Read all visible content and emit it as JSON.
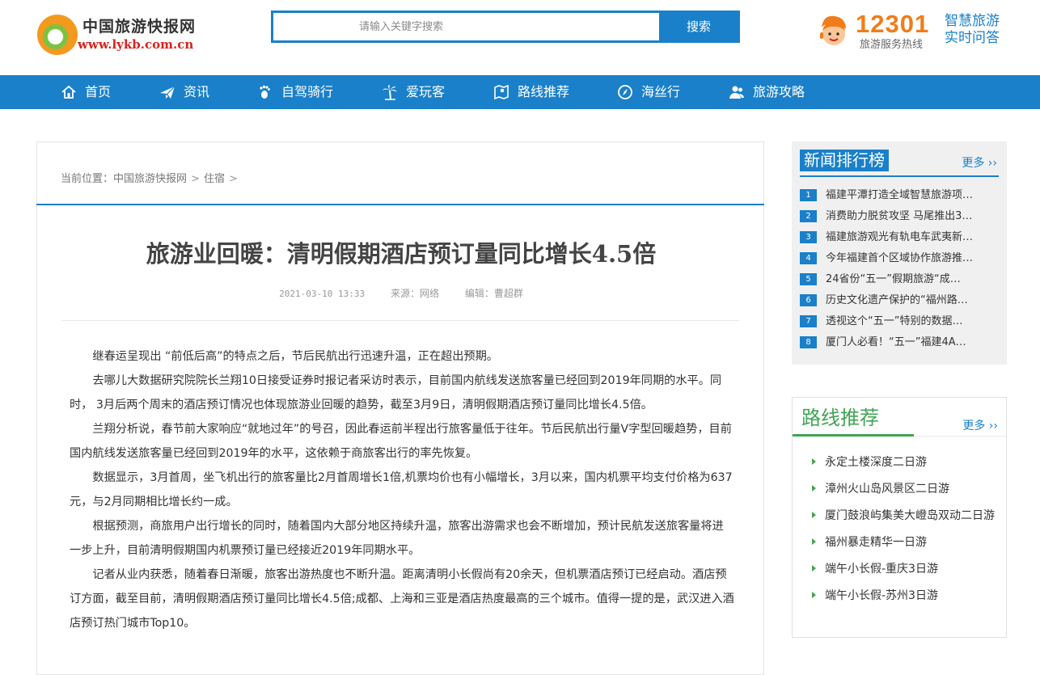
{
  "site": {
    "logo_cn": "中国旅游快报网",
    "logo_url": "www.lykb.com.cn"
  },
  "search": {
    "placeholder": "请输入关键字搜索",
    "button": "搜索"
  },
  "hotline": {
    "number": "12301",
    "label": "旅游服务热线",
    "ai_line1": "智慧旅游",
    "ai_line2": "实时问答"
  },
  "nav": {
    "items": [
      {
        "label": "首页",
        "icon": "home-icon"
      },
      {
        "label": "资讯",
        "icon": "paper-plane-icon"
      },
      {
        "label": "自驾骑行",
        "icon": "footprint-icon"
      },
      {
        "label": "爱玩客",
        "icon": "palm-tree-icon"
      },
      {
        "label": "路线推荐",
        "icon": "map-pin-icon"
      },
      {
        "label": "海丝行",
        "icon": "compass-icon"
      },
      {
        "label": "旅游攻略",
        "icon": "people-icon"
      }
    ]
  },
  "breadcrumb": {
    "prefix": "当前位置：",
    "items": [
      "中国旅游快报网",
      "住宿"
    ]
  },
  "article": {
    "title": "旅游业回暖：清明假期酒店预订量同比增长4.5倍",
    "date": "2021-03-10 13:33",
    "source": "来源：网络",
    "editor": "编辑：曹超群",
    "paragraphs": [
      "继春运呈现出 “前低后高”的特点之后，节后民航出行迅速升温，正在超出预期。",
      "去哪儿大数据研究院院长兰翔10日接受证券时报记者采访时表示，目前国内航线发送旅客量已经回到2019年同期的水平。同时， 3月后两个周末的酒店预订情况也体现旅游业回暖的趋势，截至3月9日，清明假期酒店预订量同比增长4.5倍。",
      "兰翔分析说，春节前大家响应“就地过年”的号召，因此春运前半程出行旅客量低于往年。节后民航出行量V字型回暖趋势，目前国内航线发送旅客量已经回到2019年的水平，这依赖于商旅客出行的率先恢复。",
      "数据显示，3月首周，坐飞机出行的旅客量比2月首周增长1倍,机票均价也有小幅增长，3月以来，国内机票平均支付价格为637元，与2月同期相比增长约一成。",
      "根据预测，商旅用户出行增长的同时，随着国内大部分地区持续升温，旅客出游需求也会不断增加，预计民航发送旅客量将进一步上升，目前清明假期国内机票预订量已经接近2019年同期水平。",
      "记者从业内获悉，随着春日渐暖，旅客出游热度也不断升温。距离清明小长假尚有20余天，但机票酒店预订已经启动。酒店预订方面，截至目前，清明假期酒店预订量同比增长4.5倍;成都、上海和三亚是酒店热度最高的三个城市。值得一提的是，武汉进入酒店预订热门城市Top10。"
    ]
  },
  "rank": {
    "title": "新闻排行榜",
    "more": "更多 ››",
    "items": [
      {
        "num": "1",
        "text": "福建平潭打造全域智慧旅游项…"
      },
      {
        "num": "2",
        "text": "消费助力脱贫攻坚 马尾推出3…"
      },
      {
        "num": "3",
        "text": "福建旅游观光有轨电车武夷新…"
      },
      {
        "num": "4",
        "text": "今年福建首个区域协作旅游推…"
      },
      {
        "num": "5",
        "text": "24省份“五一”假期旅游“成…"
      },
      {
        "num": "6",
        "text": "历史文化遗产保护的“福州路…"
      },
      {
        "num": "7",
        "text": "透视这个“五一”特别的数据…"
      },
      {
        "num": "8",
        "text": "厦门人必看！“五一”福建4A…"
      }
    ]
  },
  "routes": {
    "title": "路线推荐",
    "more": "更多 ››",
    "items": [
      "永定土楼深度二日游",
      "漳州火山岛风景区二日游",
      "厦门鼓浪屿集美大嶝岛双动二日游",
      "福州暴走精华一日游",
      "端午小长假-重庆3日游",
      "端午小长假-苏州3日游"
    ]
  },
  "colors": {
    "brand_blue": "#1a80c9",
    "route_green": "#3fa553",
    "hotline_orange": "#f07d1a",
    "logo_red": "#d6231c"
  }
}
